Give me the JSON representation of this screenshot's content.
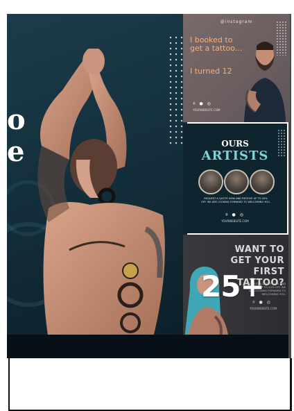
{
  "hero": {
    "side_text_line1": "o",
    "side_text_line2": "e"
  },
  "cards": {
    "booked": {
      "brand": "@instagram",
      "headline": "I booked to get a tattoo...",
      "punchline": "I turned 12",
      "social": "⌾ ● ◎",
      "site": "YOURWEBSITE.COM"
    },
    "artists": {
      "title_small": "OURS",
      "title_large": "ARTISTS",
      "description": "REQUEST A QUOTE NOW AND RECEIVE UP TO 20% OFF. WE ARE LOOKING FORWARD TO WELCOMING YOU.",
      "social": "⌾ ● ◎",
      "site": "YOURWEBSITE.COM"
    },
    "first_tattoo": {
      "headline": "WANT TO GET YOUR FIRST TATTOO?",
      "description": "REQUEST A QUOTE NOW AND RECEIVE UP TO 20% OFF. WE ARE LOOKING FORWARD TO WELCOMING YOU.",
      "social": "⌾ ● ◎",
      "site": "YOURWEBSITE.COM"
    }
  },
  "counter": "25+",
  "colors": {
    "hero_bg": "#1d3b4a",
    "accent_orange": "#f7b07a",
    "accent_teal": "#7fd2d6"
  }
}
